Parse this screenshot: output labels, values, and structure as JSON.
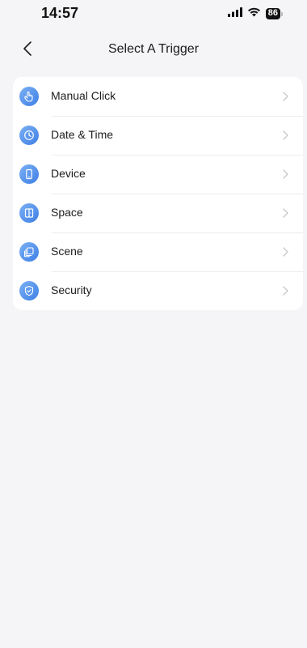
{
  "status_bar": {
    "time": "14:57",
    "battery": "86",
    "icons": [
      "signal-icon",
      "wifi-icon",
      "battery-icon"
    ]
  },
  "nav": {
    "title": "Select A Trigger",
    "back_icon": "chevron-left-icon"
  },
  "trigger_list": {
    "items": [
      {
        "label": "Manual Click",
        "icon": "hand-tap-icon"
      },
      {
        "label": "Date & Time",
        "icon": "clock-icon"
      },
      {
        "label": "Device",
        "icon": "phone-device-icon"
      },
      {
        "label": "Space",
        "icon": "door-icon"
      },
      {
        "label": "Scene",
        "icon": "layers-icon"
      },
      {
        "label": "Security",
        "icon": "shield-icon"
      }
    ]
  },
  "colors": {
    "background": "#f5f5f7",
    "card": "#ffffff",
    "icon_accent": "#3e7fe6",
    "chevron": "#c7c7cc"
  }
}
